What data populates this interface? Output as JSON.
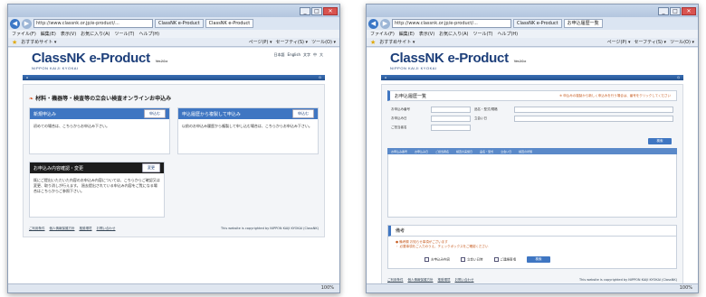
{
  "browser": {
    "address": "http://www.classnk.or.jp/e-product/...",
    "tab_left": "ClassNK e-Product",
    "tab_right": "お申込履歴一覧",
    "menu": [
      "ファイル(F)",
      "編集(E)",
      "表示(V)",
      "お気に入り(A)",
      "ツール(T)",
      "ヘルプ(H)"
    ],
    "favorites": "おすすめサイト ▾",
    "commands": [
      "ページ(P) ▾",
      "セーフティ(S) ▾",
      "ツール(O) ▾"
    ],
    "zoom": "100%"
  },
  "site": {
    "logo_main": "ClassNK",
    "logo_product": "e-Product",
    "logo_sub": "NIPPON KAIJI KYOKAI",
    "version": "Ver.2.0.x",
    "top_links": [
      "日本語",
      "English",
      "文字",
      "中",
      "大"
    ],
    "footer_links": [
      "ご利用条件",
      "個人情報保護方針",
      "推奨環境",
      "お問い合わせ"
    ],
    "copyright": "This website is copyrighted by NIPPON KAIJI KYOKAI (ClassNK)"
  },
  "left": {
    "title": "材料・機器等・検査等の立会い検査オンラインお申込み",
    "cards": [
      {
        "head": "新規申込み",
        "button": "申込む",
        "body": "初めての場合は、こちらからお申込み下さい。"
      },
      {
        "head": "申込履歴から複製して申込み",
        "button": "申込む",
        "body": "以前のお申込み履歴から複製して申し込む場合は、こちらからお申込み下さい。"
      }
    ],
    "card3": {
      "head": "お申込み内容確認・変更",
      "button": "変更",
      "body": "既にご提出いただいた内容のお申込み内容については、こちらからご確認又は変更、取り消しが行えます。 過去提出されている申込み内容をご覧になる場合はこちらからご参照下さい。"
    }
  },
  "right": {
    "list_title": "お申込履歴一覧",
    "list_note": "※ 申込みの複製から新しく申込みを行う場合は、番号をクリックしてください",
    "fields": [
      "お申込み番号",
      "品名・型式/規格",
      "お申込み日",
      "立会い日",
      "ご担当者名"
    ],
    "search": "検索",
    "columns": [
      "お申込み番号",
      "お申込み日",
      "ご担当者名",
      "検査の実施日",
      "品名・型式",
      "立会い日",
      "検査の状態"
    ],
    "memo_title": "備考",
    "memo_lines": [
      "● 備考欄 お知らせ事項がございます",
      "・ 必要事項をご入力のうえ、チェックボックスをご確認ください"
    ],
    "checks": [
      "お申込み内容",
      "立会い日時",
      "ご連絡事項"
    ],
    "submit": "検索"
  }
}
